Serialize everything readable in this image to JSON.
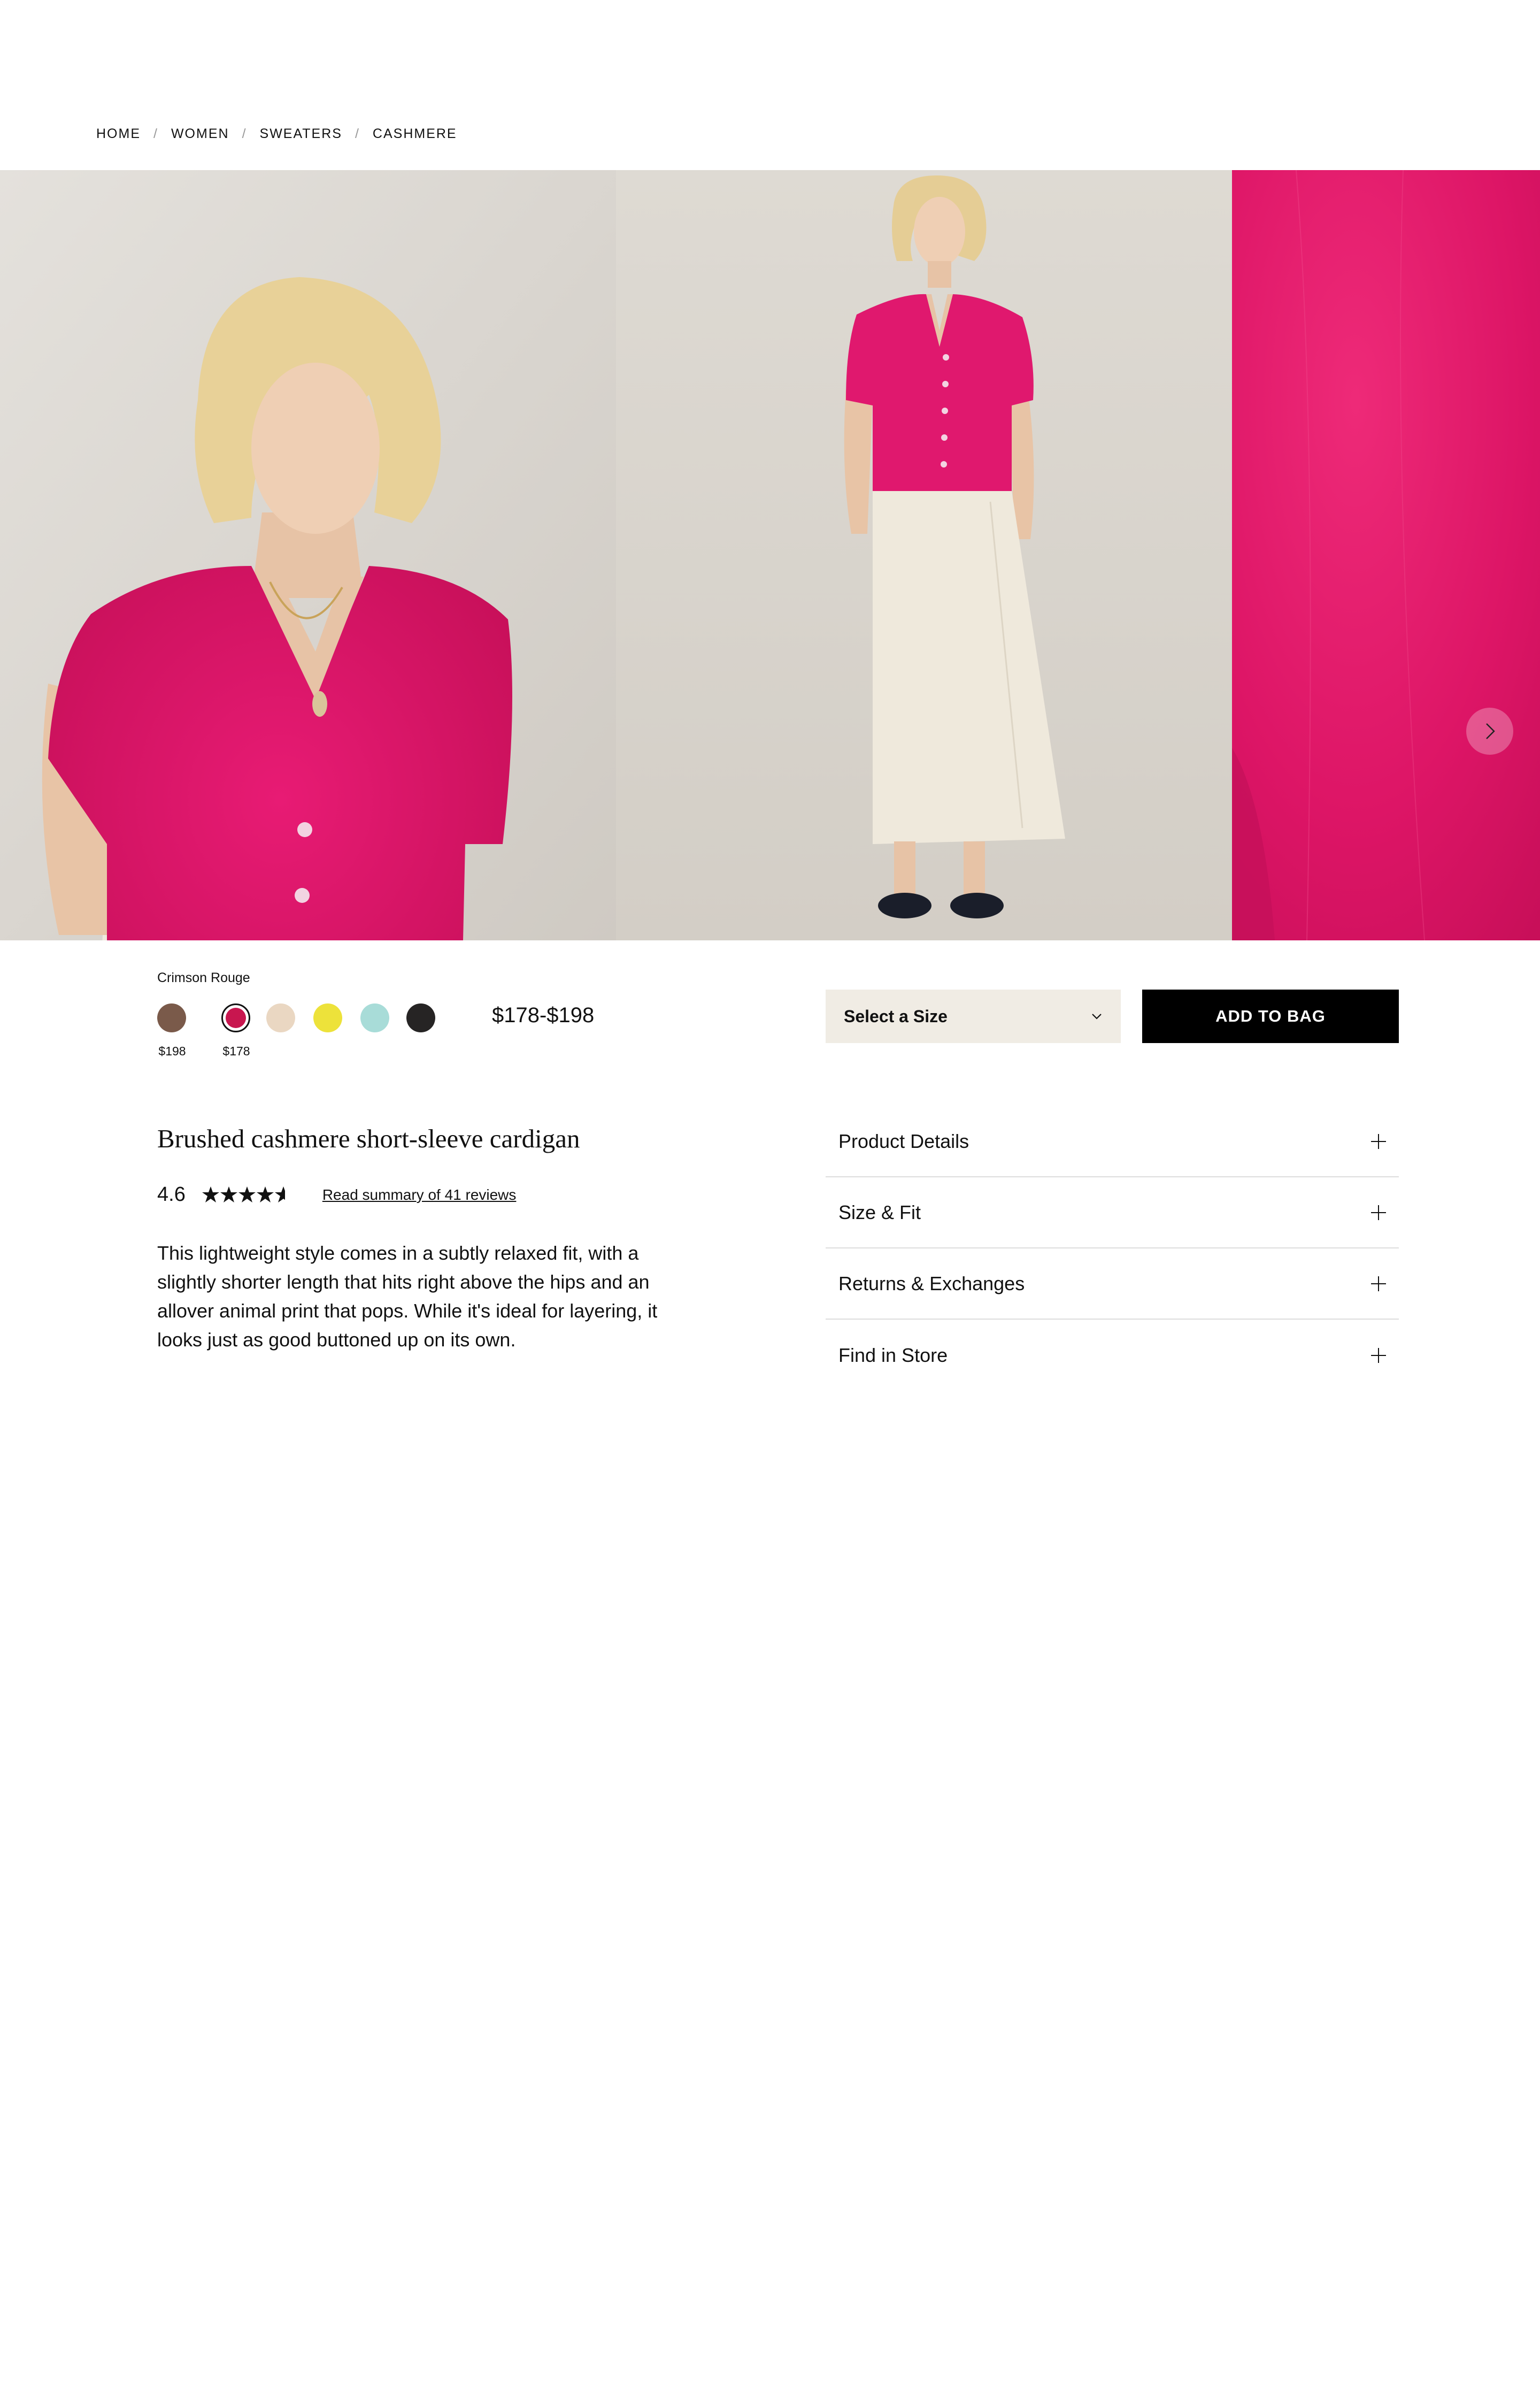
{
  "breadcrumb": {
    "items": [
      "HOME",
      "WOMEN",
      "SWEATERS",
      "CASHMERE"
    ],
    "separator": "/"
  },
  "gallery": {
    "images": [
      {
        "alt": "Model wearing Crimson Rouge cardigan, close-up"
      },
      {
        "alt": "Model wearing Crimson Rouge cardigan, full length"
      },
      {
        "alt": "Cardigan fabric texture detail"
      }
    ],
    "next_icon": "chevron-right-icon"
  },
  "product": {
    "color_name": "Crimson Rouge",
    "swatches": [
      {
        "name": "animal-print",
        "color": "#7a5a4a",
        "price": "$198"
      },
      {
        "name": "crimson-rouge",
        "color": "#c8164f",
        "price": "$178",
        "selected": true
      },
      {
        "name": "beige",
        "color": "#ead7c2"
      },
      {
        "name": "yellow",
        "color": "#ede23a"
      },
      {
        "name": "aqua",
        "color": "#a8dcd8"
      },
      {
        "name": "black",
        "color": "#262424"
      }
    ],
    "price_range": "$178-$198",
    "title": "Brushed cashmere short-sleeve cardigan",
    "rating": "4.6",
    "rating_value": 4.6,
    "reviews_link": "Read summary of 41 reviews",
    "description": "This lightweight style comes in a subtly relaxed fit, with a slightly shorter length that hits right above the hips and an allover animal print that pops. While it's ideal for layering, it looks just as good buttoned up on its own."
  },
  "purchase": {
    "size_label": "Select a Size",
    "add_to_bag": "ADD TO BAG"
  },
  "accordion": {
    "items": [
      "Product Details",
      "Size & Fit",
      "Returns & Exchanges",
      "Find in Store"
    ]
  },
  "colors": {
    "accent_pink": "#e0186e",
    "button_black": "#000000",
    "select_bg": "#f0ece4"
  }
}
